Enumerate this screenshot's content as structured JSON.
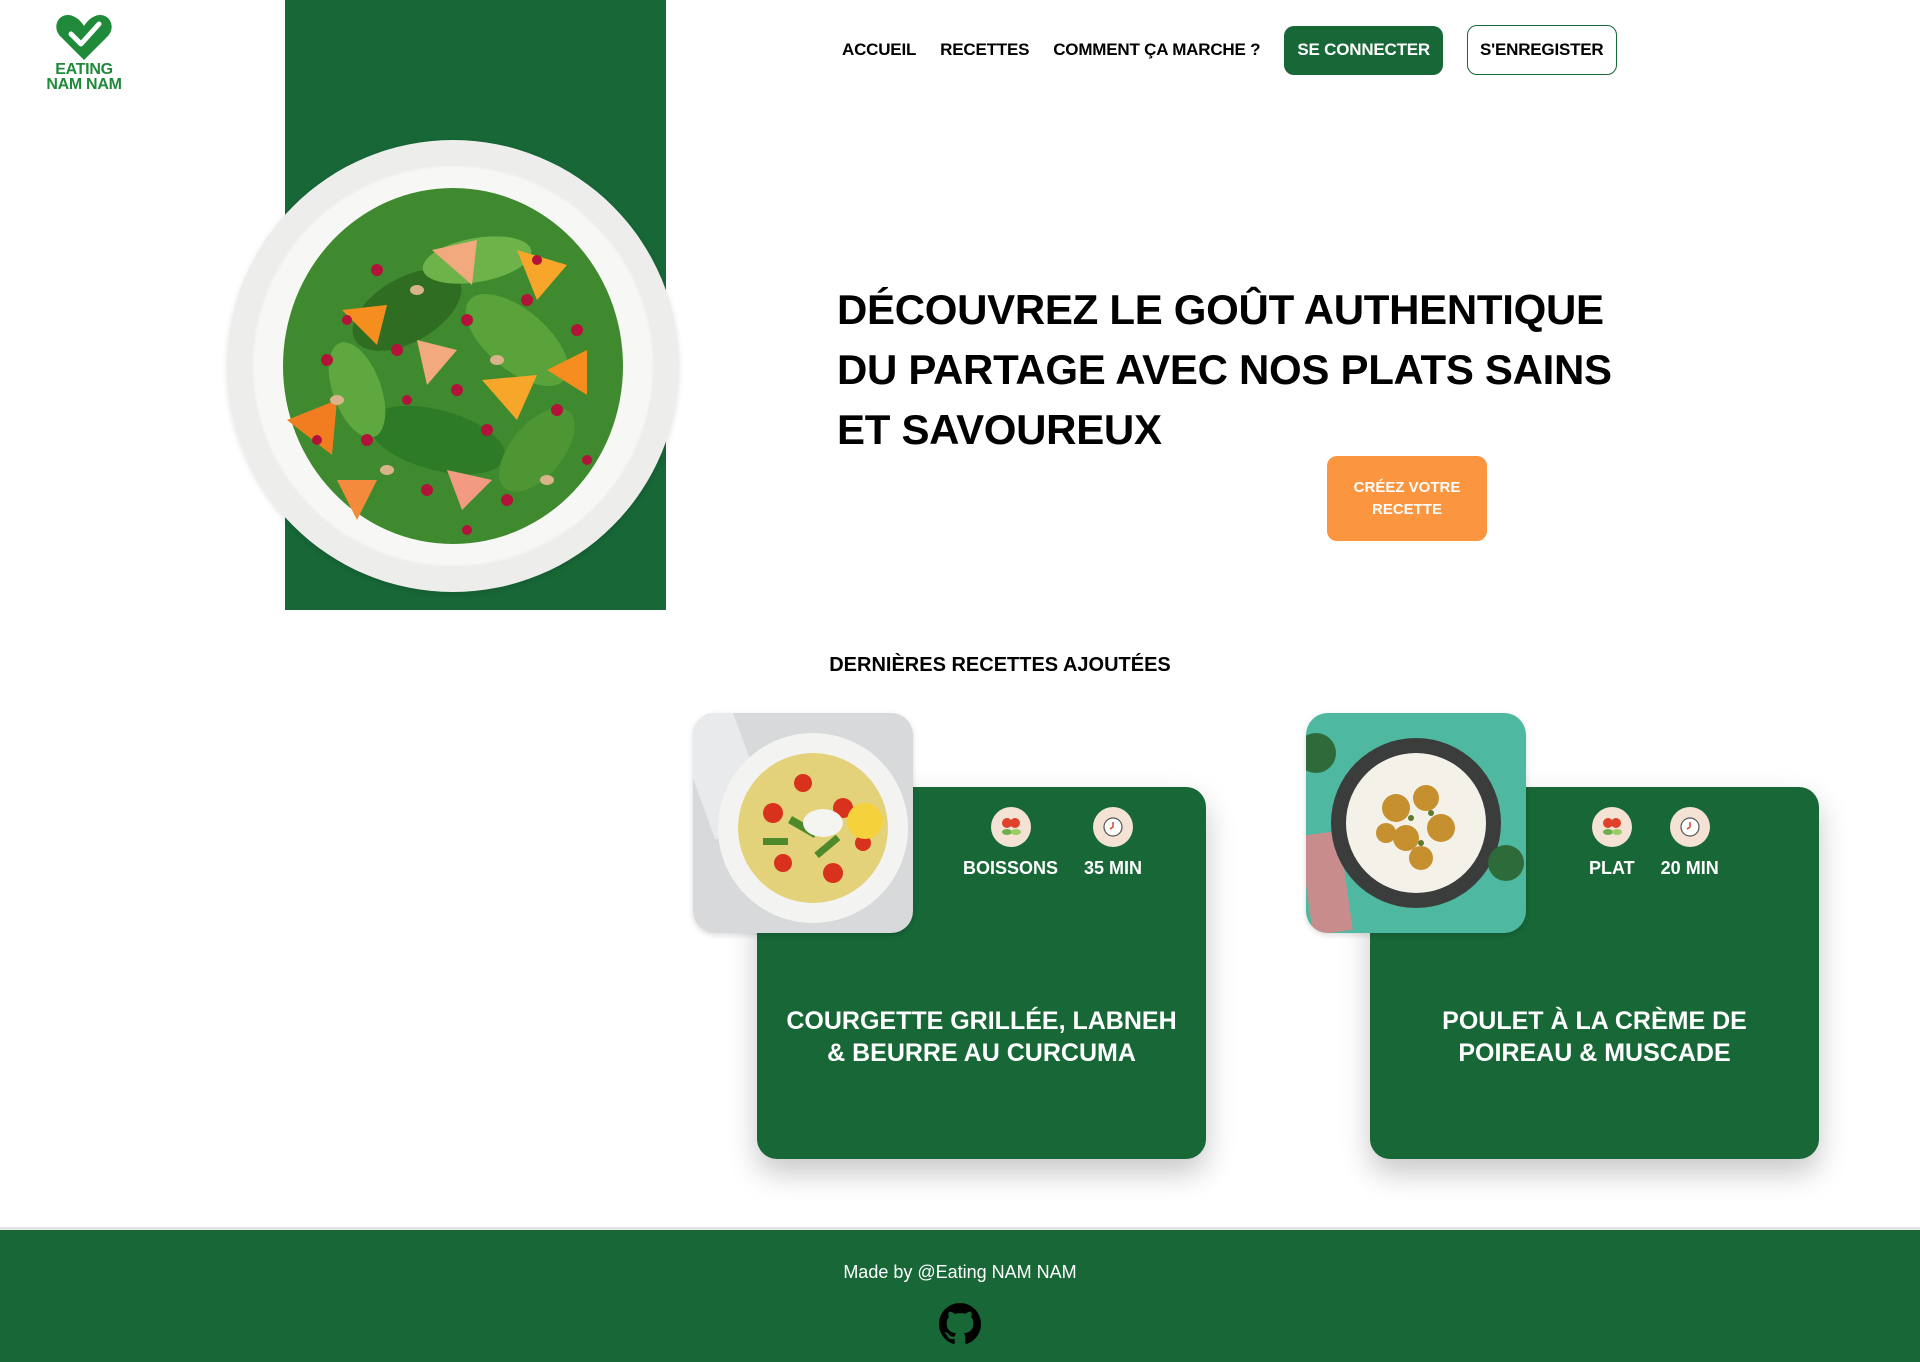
{
  "brand": {
    "line1": "EATING",
    "line2": "NAM NAM",
    "color": "#1f8a3a"
  },
  "nav": {
    "links": [
      "ACCUEIL",
      "RECETTES",
      "COMMENT ÇA MARCHE ?"
    ],
    "login_label": "SE CONNECTER",
    "register_label": "S'ENREGISTER"
  },
  "hero": {
    "title": "DÉCOUVREZ LE GOÛT AUTHENTIQUE DU PARTAGE AVEC NOS PLATS SAINS ET SAVOUREUX",
    "cta_label": "CRÉEZ VOTRE RECETTE"
  },
  "section": {
    "title": "DERNIÈRES RECETTES AJOUTÉES"
  },
  "recipes": [
    {
      "category": "BOISSONS",
      "time": "35 MIN",
      "title": "COURGETTE GRILLÉE, LABNEH & BEURRE AU CURCUMA"
    },
    {
      "category": "PLAT",
      "time": "20 MIN",
      "title": "POULET À LA CRÈME DE POIREAU & MUSCADE"
    }
  ],
  "footer": {
    "text": "Made by @Eating NAM NAM",
    "icon": "github-icon"
  },
  "colors": {
    "primary": "#176737",
    "accent": "#fb953f"
  }
}
